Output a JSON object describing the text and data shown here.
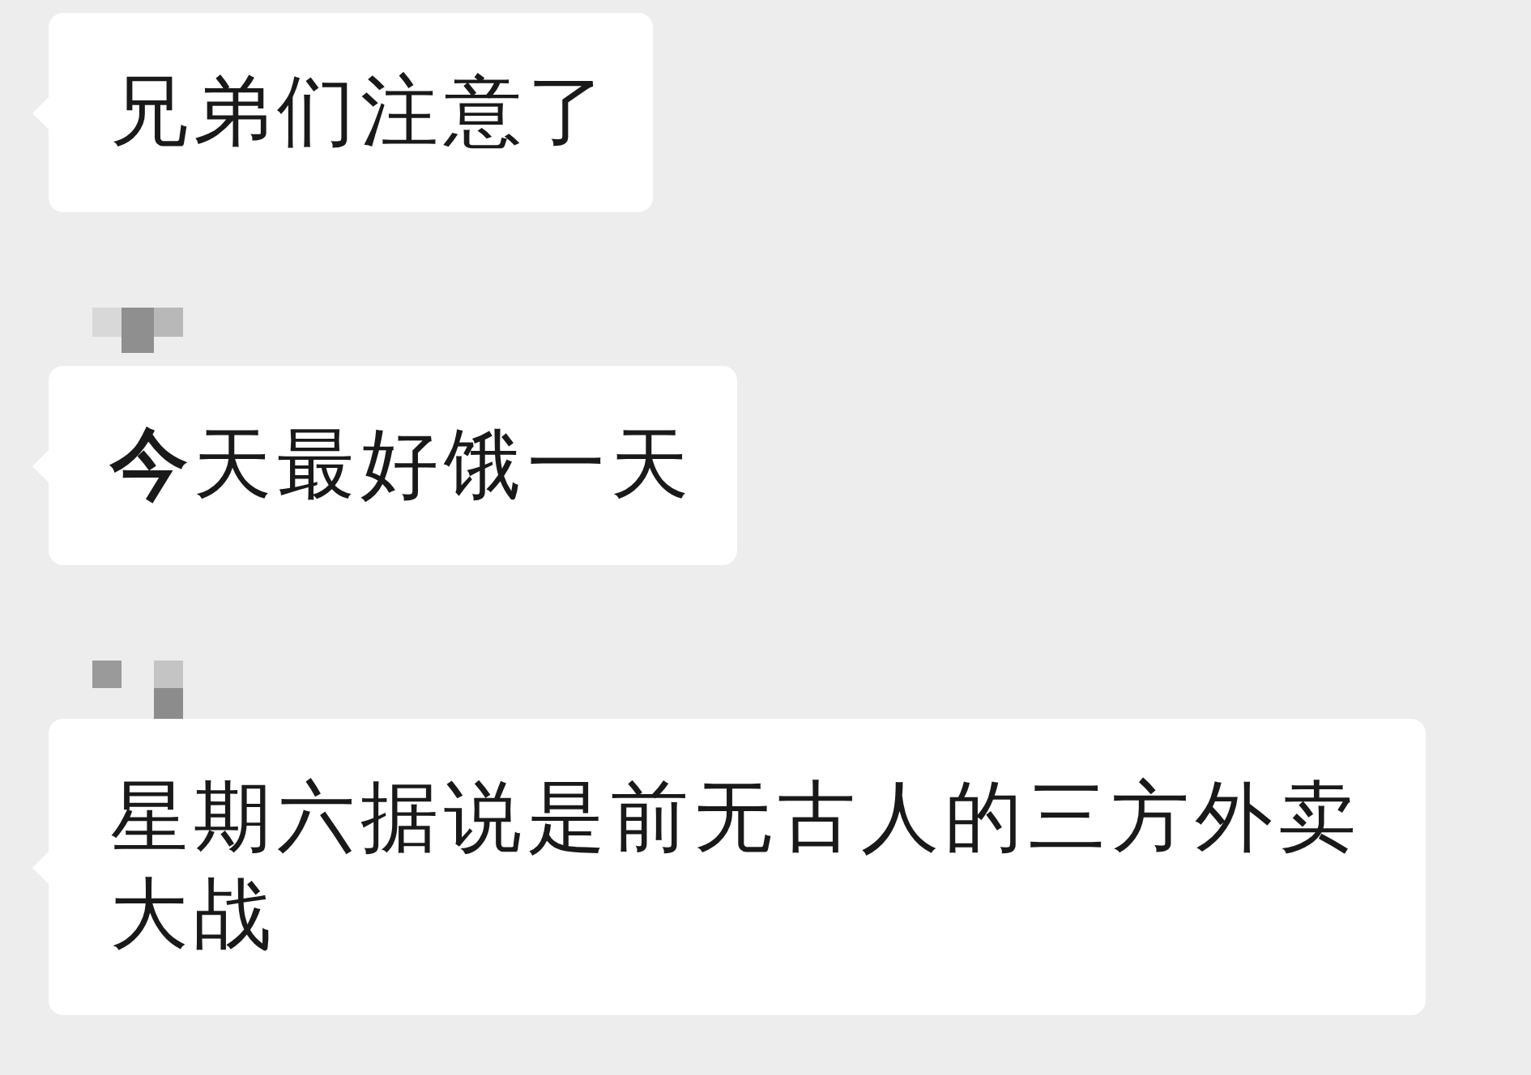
{
  "messages": [
    {
      "text": "兄弟们注意了",
      "sender_masked": false
    },
    {
      "text": "**今**天最好饿一天",
      "sender_masked": true
    },
    {
      "text": "星期六据说是前无古人的三方外卖大战",
      "sender_masked": true
    }
  ]
}
